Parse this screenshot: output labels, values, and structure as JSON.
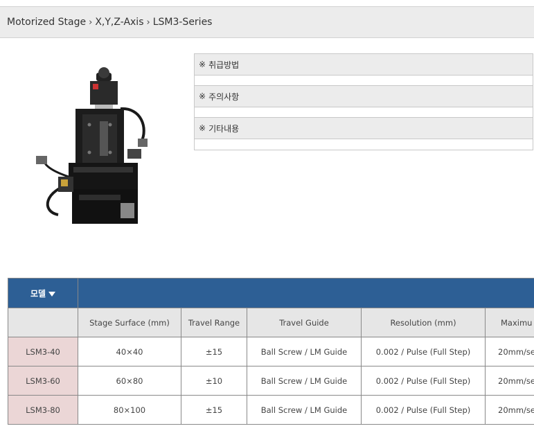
{
  "breadcrumb": {
    "items": [
      "Motorized Stage",
      "X,Y,Z-Axis",
      "LSM3-Series"
    ],
    "separator": "›"
  },
  "product_image": {
    "icon": "xyz-motorized-stage-photo"
  },
  "info_panel": {
    "mark": "※",
    "sections": [
      {
        "title": "취급방법"
      },
      {
        "title": "주의사항"
      },
      {
        "title": "기타내용"
      }
    ]
  },
  "spec_table": {
    "model_button": "모델",
    "header_color": "#2d5f95",
    "columns": [
      "",
      "Stage Surface (mm)",
      "Travel Range",
      "Travel Guide",
      "Resolution (mm)",
      "Maximu"
    ],
    "rows": [
      {
        "model": "LSM3-40",
        "surface": "40×40",
        "travel": "±15",
        "guide": "Ball Screw / LM Guide",
        "resolution": "0.002 / Pulse (Full Step)",
        "max": "20mm/se"
      },
      {
        "model": "LSM3-60",
        "surface": "60×80",
        "travel": "±10",
        "guide": "Ball Screw / LM Guide",
        "resolution": "0.002 / Pulse (Full Step)",
        "max": "20mm/se"
      },
      {
        "model": "LSM3-80",
        "surface": "80×100",
        "travel": "±15",
        "guide": "Ball Screw / LM Guide",
        "resolution": "0.002 / Pulse (Full Step)",
        "max": "20mm/se"
      }
    ]
  }
}
